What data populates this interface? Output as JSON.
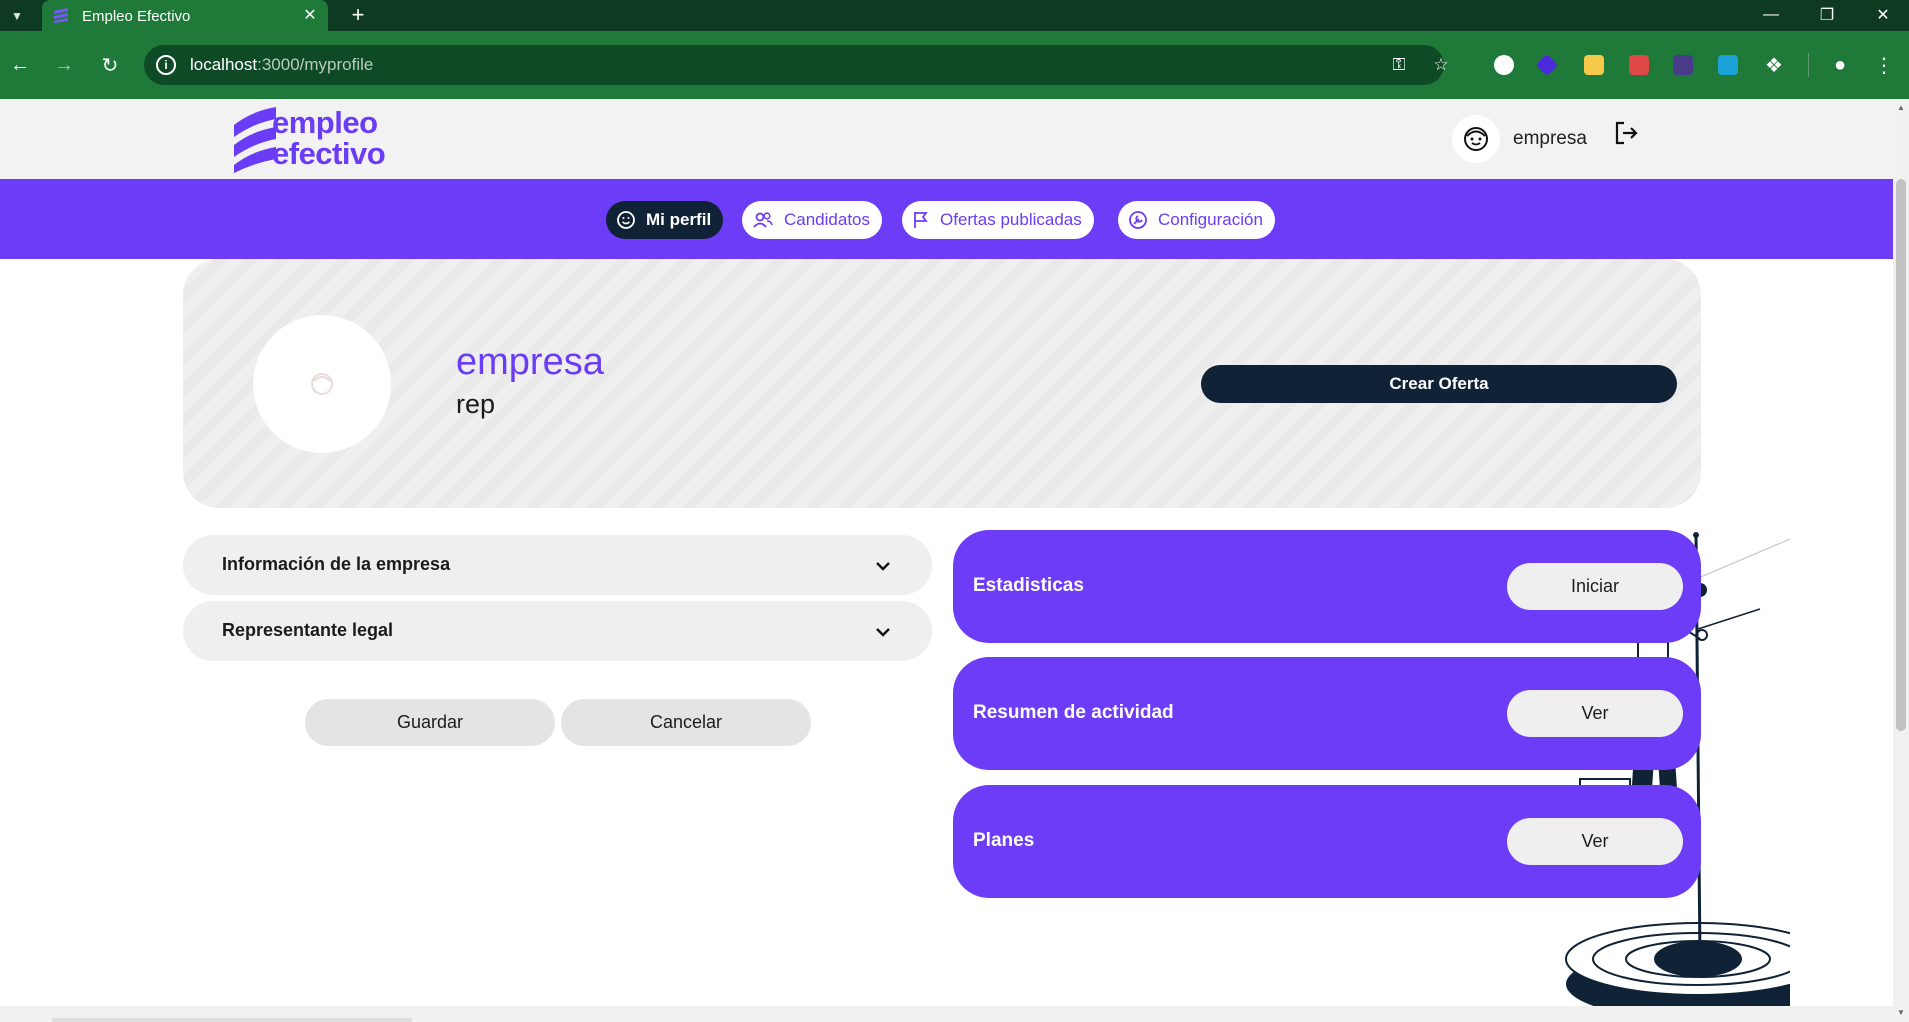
{
  "browser": {
    "tab_title": "Empleo Efectivo",
    "url_host": "localhost",
    "url_path": ":3000/myprofile",
    "colors": {
      "tabbar": "#0e3a22",
      "toolbar": "#1f7a3a"
    }
  },
  "header": {
    "logo_line1": "empleo",
    "logo_line2": "efectivo",
    "user_name": "empresa",
    "logout_icon": "logout-icon"
  },
  "nav": {
    "items": [
      {
        "label": "Mi perfil",
        "icon": "smiley-icon",
        "active": true
      },
      {
        "label": "Candidatos",
        "icon": "users-icon",
        "active": false
      },
      {
        "label": "Ofertas publicadas",
        "icon": "flag-icon",
        "active": false
      },
      {
        "label": "Configuración",
        "icon": "settings-icon",
        "active": false
      }
    ]
  },
  "profile": {
    "name": "empresa",
    "rep": "rep",
    "create_offer_label": "Crear Oferta"
  },
  "sections": [
    {
      "label": "Información de la empresa"
    },
    {
      "label": "Representante legal"
    }
  ],
  "form_actions": {
    "save_label": "Guardar",
    "cancel_label": "Cancelar"
  },
  "cards": [
    {
      "label": "Estadisticas",
      "button": "Iniciar"
    },
    {
      "label": "Resumen de actividad",
      "button": "Ver"
    },
    {
      "label": "Planes",
      "button": "Ver"
    }
  ],
  "theme": {
    "primary": "#6c3cf7",
    "dark": "#0f2236",
    "surface": "#f0efef"
  }
}
